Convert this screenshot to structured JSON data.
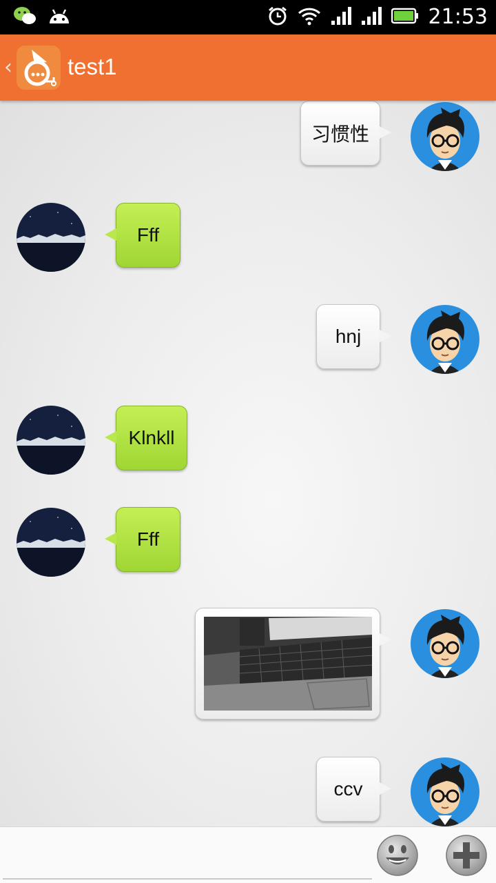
{
  "status_bar": {
    "time": "21:53",
    "left_icons": [
      "wechat-icon",
      "android-icon"
    ],
    "right_icons": [
      "alarm-icon",
      "wifi-icon",
      "signal-icon",
      "signal-icon",
      "battery-icon"
    ]
  },
  "header": {
    "title": "test1",
    "back_glyph": "‹"
  },
  "messages": [
    {
      "side": "right",
      "type": "text",
      "text": "习惯性"
    },
    {
      "side": "left",
      "type": "text",
      "text": "Fff"
    },
    {
      "side": "right",
      "type": "text",
      "text": "hnj"
    },
    {
      "side": "left",
      "type": "text",
      "text": "Klnkll"
    },
    {
      "side": "left",
      "type": "text",
      "text": "Fff"
    },
    {
      "side": "right",
      "type": "image",
      "image": "laptop-keyboard-photo"
    },
    {
      "side": "right",
      "type": "text",
      "text": "ccv"
    }
  ],
  "input": {
    "value": "",
    "placeholder": ""
  },
  "colors": {
    "header": "#ef7030",
    "incoming_bubble": "#b5e448",
    "outgoing_bubble": "#f5f5f5",
    "avatar_bg": "#2b8fe0"
  }
}
